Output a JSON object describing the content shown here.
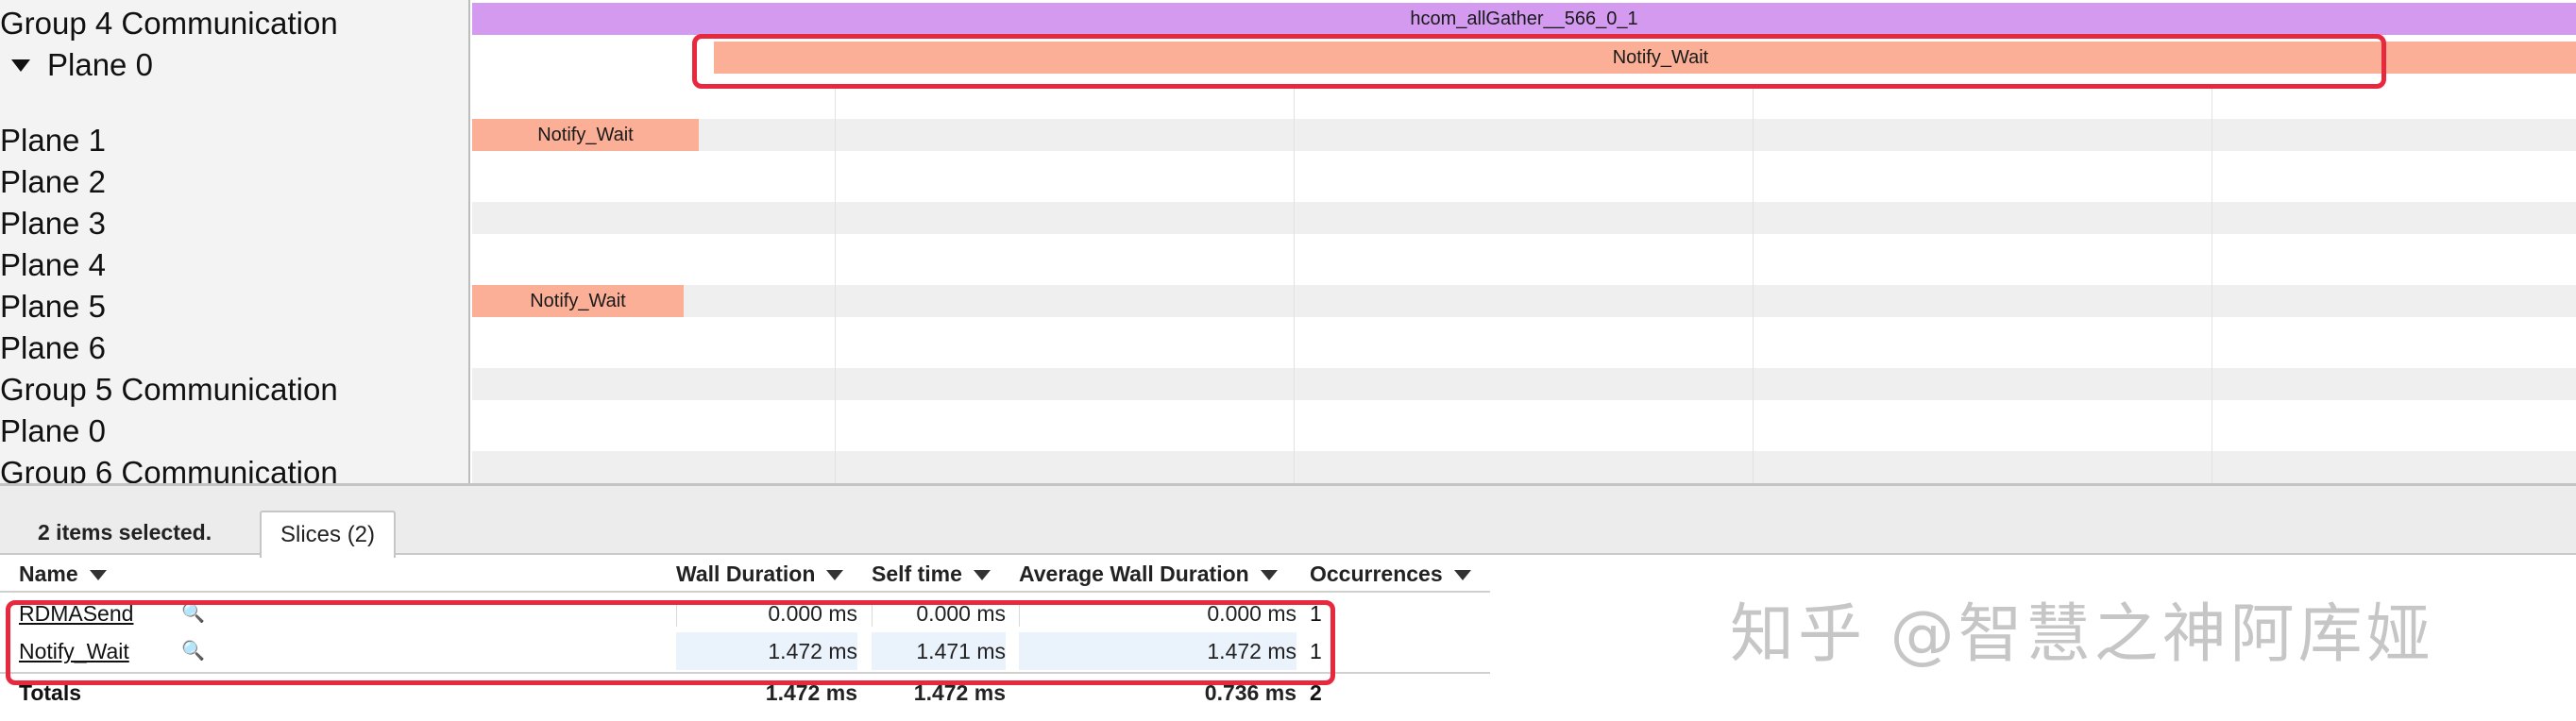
{
  "tracks": {
    "group4": "Group 4 Communication",
    "plane0": "Plane 0",
    "plane1": "Plane 1",
    "plane2": "Plane 2",
    "plane3": "Plane 3",
    "plane4": "Plane 4",
    "plane5": "Plane 5",
    "plane6": "Plane 6",
    "group5": "Group 5 Communication",
    "g5plane0": "Plane 0",
    "group6": "Group 6 Communication"
  },
  "slices": {
    "allgather": "hcom_allGather__566_0_1",
    "plane0_notify": "Notify_Wait",
    "plane1_notify": "Notify_Wait",
    "plane5_notify": "Notify_Wait"
  },
  "colors": {
    "purple_slice": "#d39af0",
    "salmon_slice": "#fbaf96",
    "highlight_box": "#e8283c"
  },
  "panel": {
    "selection_text": "2 items selected.",
    "tab_label": "Slices (2)"
  },
  "table": {
    "headers": {
      "name": "Name",
      "wall": "Wall Duration",
      "self": "Self time",
      "avg": "Average Wall Duration",
      "occ": "Occurrences"
    },
    "rows": [
      {
        "name": "RDMASend",
        "wall": "0.000 ms",
        "self": "0.000 ms",
        "avg": "0.000 ms",
        "occ": "1"
      },
      {
        "name": "Notify_Wait",
        "wall": "1.472 ms",
        "self": "1.471 ms",
        "avg": "1.472 ms",
        "occ": "1"
      }
    ],
    "totals": {
      "label": "Totals",
      "wall": "1.472 ms",
      "self": "1.472 ms",
      "avg": "0.736 ms",
      "occ": "2"
    }
  },
  "watermark": "知乎 @智慧之神阿库娅"
}
